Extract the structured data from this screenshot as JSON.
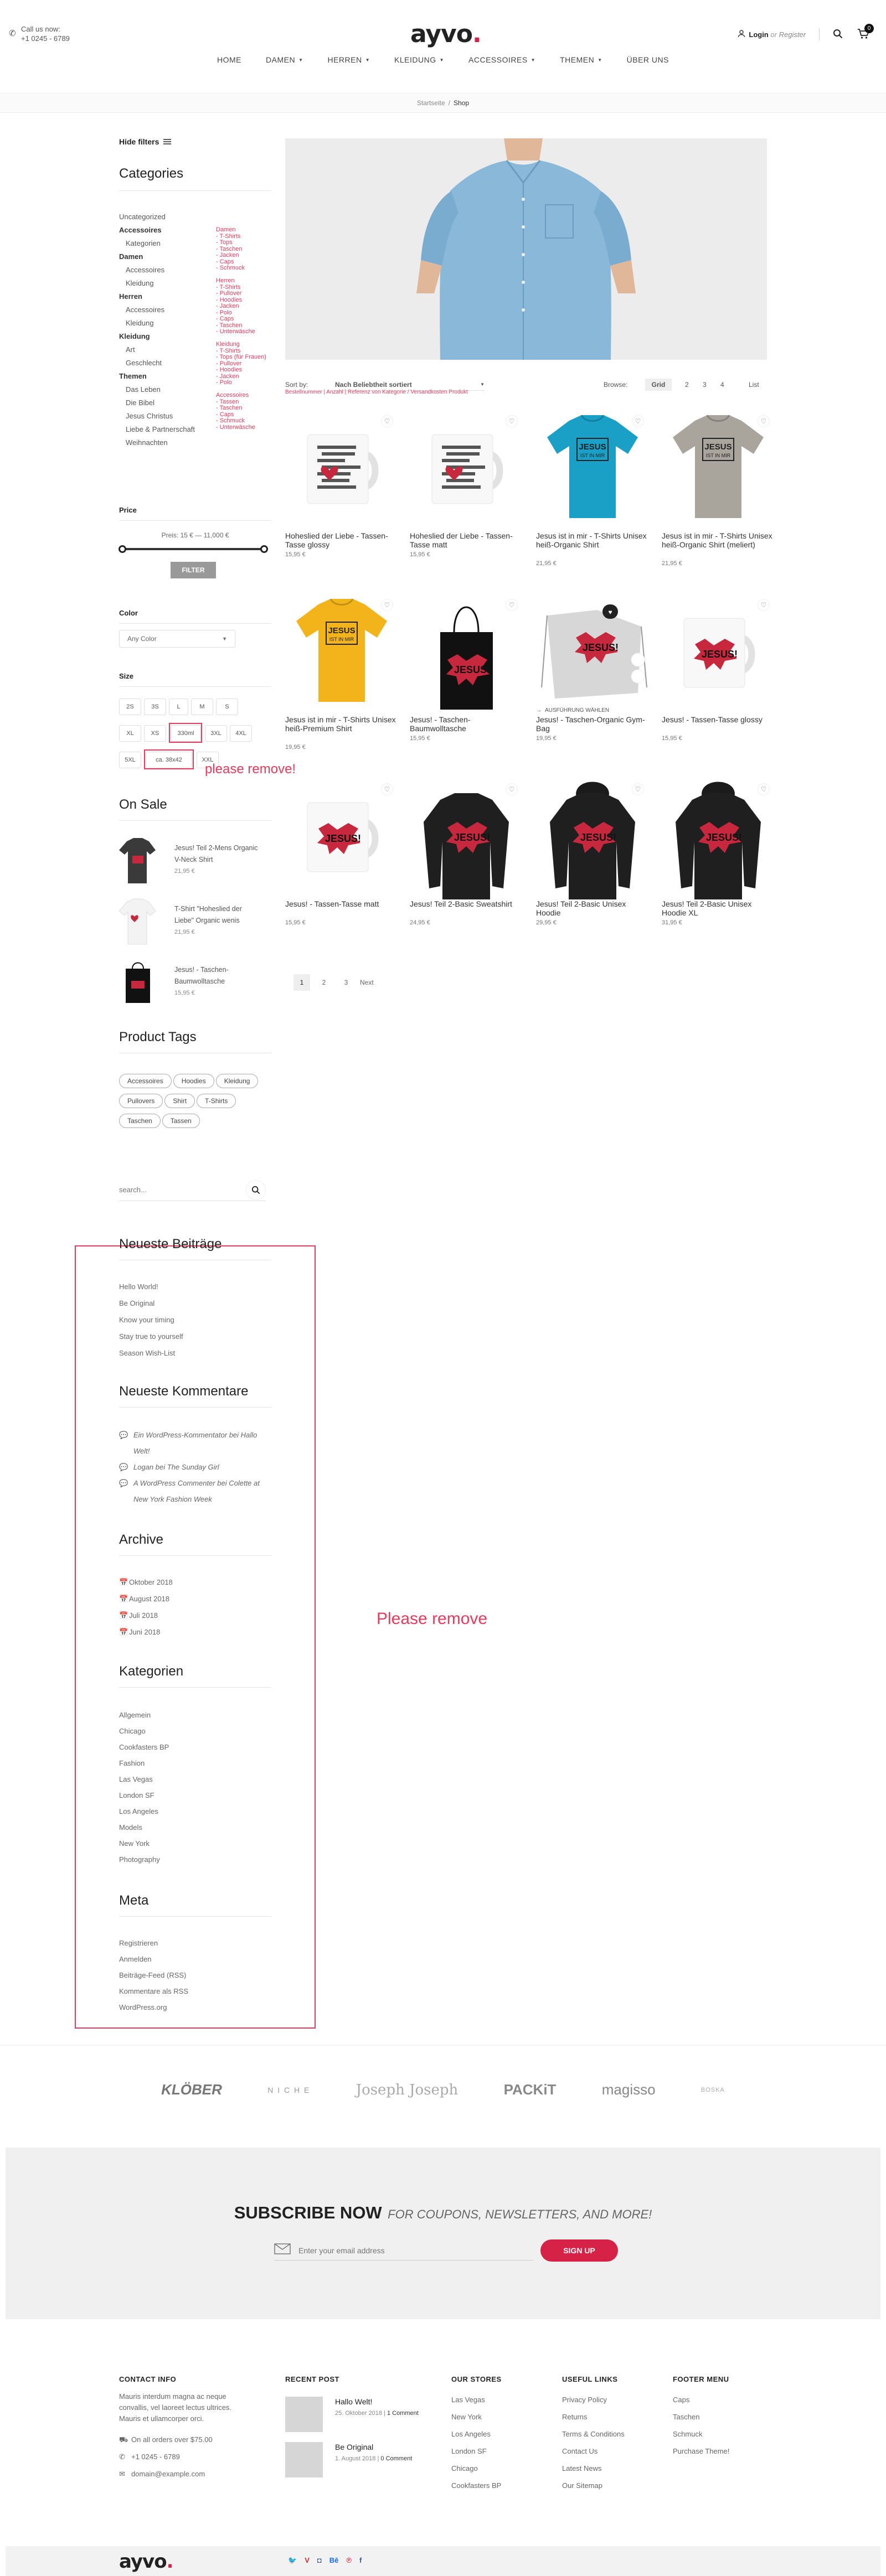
{
  "header": {
    "call_label": "Call us now:",
    "phone": "+1 0245 - 6789",
    "logo_text": "ayvo",
    "logo_dot": ".",
    "login": "Login",
    "or": "or",
    "register": "Register",
    "cart_count": "0",
    "nav": [
      "HOME",
      "DAMEN",
      "HERREN",
      "KLEIDUNG",
      "ACCESSOIRES",
      "THEMEN",
      "ÜBER UNS"
    ],
    "nav_dropdown": [
      false,
      true,
      true,
      true,
      true,
      true,
      false
    ]
  },
  "breadcrumb": {
    "home": "Startseite",
    "sep": "/",
    "current": "Shop"
  },
  "sidebar": {
    "hide_filters": "Hide filters",
    "categories_title": "Categories",
    "categories": [
      {
        "label": "Uncategorized",
        "level": 0,
        "bold": false
      },
      {
        "label": "Accessoires",
        "level": 0,
        "bold": true
      },
      {
        "label": "Kategorien",
        "level": 1,
        "bold": false
      },
      {
        "label": "Damen",
        "level": 0,
        "bold": true
      },
      {
        "label": "Accessoires",
        "level": 1,
        "bold": false
      },
      {
        "label": "Kleidung",
        "level": 1,
        "bold": false
      },
      {
        "label": "Herren",
        "level": 0,
        "bold": true
      },
      {
        "label": "Accessoires",
        "level": 1,
        "bold": false
      },
      {
        "label": "Kleidung",
        "level": 1,
        "bold": false
      },
      {
        "label": "Kleidung",
        "level": 0,
        "bold": true
      },
      {
        "label": "Art",
        "level": 1,
        "bold": false
      },
      {
        "label": "Geschlecht",
        "level": 1,
        "bold": false
      },
      {
        "label": "Themen",
        "level": 0,
        "bold": true
      },
      {
        "label": "Das Leben",
        "level": 1,
        "bold": false
      },
      {
        "label": "Die Bibel",
        "level": 1,
        "bold": false
      },
      {
        "label": "Jesus Christus",
        "level": 1,
        "bold": false
      },
      {
        "label": "Liebe & Partnerschaft",
        "level": 1,
        "bold": false
      },
      {
        "label": "Weihnachten",
        "level": 1,
        "bold": false
      }
    ],
    "pink_categories": [
      "Damen",
      "- T-Shirts",
      "- Tops",
      "- Taschen",
      "- Jacken",
      "- Caps",
      "- Schmuck",
      "",
      "Herren",
      "- T-Shirts",
      "- Pullover",
      "- Hoodies",
      "- Jacken",
      "- Polo",
      "- Caps",
      "- Taschen",
      "- Unterwäsche",
      "",
      "Kleidung",
      "- T-Shirts",
      "- Tops (für Frauen)",
      "- Pullover",
      "- Hoodies",
      "- Jacken",
      "- Polo",
      "",
      "Accessoires",
      "- Tassen",
      "- Taschen",
      "- Caps",
      "- Schmuck",
      "- Unterwäsche"
    ],
    "price_title": "Price",
    "price_range": "Preis: 15 € — 11,000 €",
    "filter_button": "FILTER",
    "color_title": "Color",
    "color_select": "Any Color",
    "size_title": "Size",
    "sizes": [
      "2S",
      "3S",
      "L",
      "M",
      "S",
      "XL",
      "XS",
      "330ml",
      "3XL",
      "4XL",
      "5XL",
      "ca. 38x42",
      "XXL"
    ],
    "please_remove_small": "please remove!",
    "onsale_title": "On Sale",
    "onsale": [
      {
        "name": "Jesus! Teil 2-Mens Organic V-Neck Shirt",
        "price": "21,95 €"
      },
      {
        "name": "T-Shirt \"Hoheslied der Liebe\" Organic wenis",
        "price": "21,95 €"
      },
      {
        "name": "Jesus! - Taschen-Baumwolltasche",
        "price": "15,95 €"
      }
    ],
    "tags_title": "Product Tags",
    "tags": [
      "Accessoires",
      "Hoodies",
      "Kleidung",
      "Pullovers",
      "Shirt",
      "T-Shirts",
      "Taschen",
      "Tassen"
    ],
    "search_placeholder": "search...",
    "posts_title": "Neueste Beiträge",
    "posts": [
      "Hello World!",
      "Be Original",
      "Know your timing",
      "Stay true to yourself",
      "Season Wish-List"
    ],
    "comments_title": "Neueste Kommentare",
    "comments": [
      {
        "author": "Ein WordPress-Kommentator",
        "on": "bei",
        "post": "Hallo Welt!"
      },
      {
        "author": "Logan",
        "on": "bei",
        "post": "The Sunday Girl"
      },
      {
        "author": "A WordPress Commenter",
        "on": "bei",
        "post": "Colette at New York Fashion Week"
      }
    ],
    "archive_title": "Archive",
    "archive": [
      "Oktober 2018",
      "August 2018",
      "Juli 2018",
      "Juni 2018"
    ],
    "kategorien_title": "Kategorien",
    "kategorien": [
      "Allgemein",
      "Chicago",
      "Cookfasters BP",
      "Fashion",
      "Las Vegas",
      "London SF",
      "Los Angeles",
      "Models",
      "New York",
      "Photography"
    ],
    "meta_title": "Meta",
    "meta": [
      "Registrieren",
      "Anmelden",
      "Beiträge-Feed (RSS)",
      "Kommentare als RSS",
      "WordPress.org"
    ]
  },
  "annotation_big": "Please remove",
  "toolbar": {
    "sort_label": "Sort by:",
    "sort_value": "Nach Beliebtheit sortiert",
    "pink_sort_note": "Bestellnummer | Anzahl | Referenz von Kategorie / Versandkosten Produkt",
    "browse_label": "Browse:",
    "grid": "Grid",
    "pages": [
      "2",
      "3",
      "4"
    ],
    "list": "List"
  },
  "products": [
    {
      "name": "Hoheslied der Liebe - Tassen-Tasse glossy",
      "price": "15,95 €",
      "kind": "mug-text"
    },
    {
      "name": "Hoheslied der Liebe - Tassen-Tasse matt",
      "price": "15,95 €",
      "kind": "mug-text"
    },
    {
      "name": "Jesus ist in mir - T-Shirts Unisex heiß-Organic Shirt",
      "price": "21,95 €",
      "kind": "shirt-blue"
    },
    {
      "name": "Jesus ist in mir - T-Shirts Unisex heiß-Organic Shirt (meliert)",
      "price": "21,95 €",
      "kind": "shirt-grey"
    },
    {
      "name": "Jesus ist in mir - T-Shirts Unisex heiß-Premium Shirt",
      "price": "19,95 €",
      "kind": "shirt-yellow"
    },
    {
      "name": "Jesus! - Taschen-Baumwolltasche",
      "price": "15,95 €",
      "kind": "bag-black"
    },
    {
      "name": "Jesus! - Taschen-Organic Gym-Bag",
      "price": "19,95 €",
      "kind": "gymbag"
    },
    {
      "name": "Jesus! - Tassen-Tasse glossy",
      "price": "15,95 €",
      "kind": "mug-red"
    },
    {
      "name": "Jesus! - Tassen-Tasse matt",
      "price": "15,95 €",
      "kind": "mug-red"
    },
    {
      "name": "Jesus! Teil 2-Basic Sweatshirt",
      "price": "24,95 €",
      "kind": "sweat-black"
    },
    {
      "name": "Jesus! Teil 2-Basic Unisex Hoodie",
      "price": "29,95 €",
      "kind": "hoodie-black"
    },
    {
      "name": "Jesus! Teil 2-Basic Unisex Hoodie XL",
      "price": "31,95 €",
      "kind": "hoodie-black"
    }
  ],
  "select_options": "AUSFÜHRUNG WÄHLEN",
  "pagination": {
    "pages": [
      "1",
      "2",
      "3"
    ],
    "next": "Next"
  },
  "brands": [
    "KLÖBER",
    "N I C H E",
    "Joseph Joseph",
    "PACKiT",
    "magisso",
    "BOSKA"
  ],
  "subscribe": {
    "title": "SUBSCRIBE NOW",
    "subtitle": "FOR COUPONS, NEWSLETTERS, AND MORE!",
    "placeholder": "Enter your email address",
    "button": "SIGN UP"
  },
  "footer": {
    "contact_title": "CONTACT INFO",
    "contact_text": "Mauris interdum magna ac neque convallis, vel laoreet lectus ultrices. Mauris et ullamcorper orci.",
    "contact_shipping": "On all orders over $75.00",
    "contact_phone": "+1 0245 - 6789",
    "contact_email": "domain@example.com",
    "recent_title": "RECENT POST",
    "recent": [
      {
        "title": "Hallo Welt!",
        "date": "25. Oktober 2018",
        "comments": "1 Comment"
      },
      {
        "title": "Be Original",
        "date": "1. August 2018",
        "comments": "0 Comment"
      }
    ],
    "stores_title": "OUR STORES",
    "stores": [
      "Las Vegas",
      "New York",
      "Los Angeles",
      "London SF",
      "Chicago",
      "Cookfasters BP"
    ],
    "links_title": "USEFUL LINKS",
    "links": [
      "Privacy Policy",
      "Returns",
      "Terms & Conditions",
      "Contact Us",
      "Latest News",
      "Our Sitemap"
    ],
    "menu_title": "FOOTER MENU",
    "menu": [
      "Caps",
      "Taschen",
      "Schmuck",
      "Purchase Theme!"
    ]
  },
  "colors": {
    "accent": "#d62246",
    "annotation": "#e53b5c",
    "dark": "#222222"
  }
}
